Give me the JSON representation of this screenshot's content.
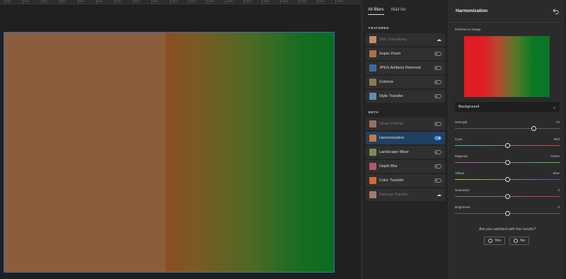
{
  "canvas": {
    "ruler_numbers": [
      "100",
      "200",
      "300",
      "400",
      "500",
      "600",
      "700",
      "800",
      "900",
      "1000",
      "1100",
      "1200",
      "1300",
      "1400",
      "1500",
      "1600",
      "1700",
      "1800",
      "1900"
    ],
    "photo_left_color": "#8a5e3a",
    "photo_right_gradient": "linear-gradient(90deg, #8b4f22 0%, #7a5a24 20%, #4f6924 50%, #176d22 80%, #0a6d1c 100%)"
  },
  "filters": {
    "tabs": [
      {
        "label": "All filters",
        "active": true
      },
      {
        "label": "Wait list",
        "active": false
      }
    ],
    "featured_title": "FEATURED",
    "beta_title": "BETA",
    "featured": [
      {
        "label": "Skin Smoothing",
        "thumb": "#c38c6a",
        "control": "cloud",
        "dim": true
      },
      {
        "label": "Super Zoom",
        "thumb": "#b06e4e",
        "control": "toggle",
        "on": false
      },
      {
        "label": "JPEG Artifacts Removal",
        "thumb": "#3b6aa0",
        "control": "toggle",
        "on": false
      },
      {
        "label": "Colorize",
        "thumb": "#8b7b52",
        "control": "toggle",
        "on": false
      },
      {
        "label": "Style Transfer",
        "thumb": "#5f8fb0",
        "control": "toggle",
        "on": false
      }
    ],
    "beta": [
      {
        "label": "Smart Portrait",
        "thumb": "#9a7060",
        "control": "toggle",
        "on": false,
        "dim": true
      },
      {
        "label": "Harmonization",
        "thumb": "#c47b3e",
        "control": "toggle",
        "on": true,
        "active": true
      },
      {
        "label": "Landscape Mixer",
        "thumb": "#7a8a5a",
        "control": "toggle",
        "on": false
      },
      {
        "label": "Depth Blur",
        "thumb": "#b05a6a",
        "control": "toggle",
        "on": false
      },
      {
        "label": "Color Transfer",
        "thumb": "#d06a2e",
        "control": "toggle",
        "on": false
      },
      {
        "label": "Makeup Transfer",
        "thumb": "#a87a6a",
        "control": "cloud",
        "dim": true
      }
    ]
  },
  "panel": {
    "title": "Harmonization",
    "reference_label": "Reference image",
    "select_value": "Background",
    "sliders": [
      {
        "id": "strength",
        "left": "Strength",
        "right": "75",
        "value": 0.75,
        "track": "#5d5d5d"
      },
      {
        "id": "cyan-red",
        "left": "Cyan",
        "right": "Red",
        "value": 0.5,
        "track": "linear-gradient(90deg,#3fb8c8,#c84040)"
      },
      {
        "id": "magenta-green",
        "left": "Magenta",
        "right": "Green",
        "value": 0.5,
        "track": "linear-gradient(90deg,#b84cb8,#4cb84c)"
      },
      {
        "id": "yellow-blue",
        "left": "Yellow",
        "right": "Blue",
        "value": 0.5,
        "track": "linear-gradient(90deg,#c8c040,#4050c8)"
      },
      {
        "id": "saturation",
        "left": "Saturation",
        "right": "0",
        "value": 0.5,
        "track": "linear-gradient(90deg,#7a7a7a,#c84040)"
      },
      {
        "id": "brightness",
        "left": "Brightness",
        "right": "0",
        "value": 0.5,
        "track": "#5d5d5d"
      }
    ],
    "satisfied_text": "Are you satisfied with the results?",
    "yes_label": "Yes",
    "no_label": "No"
  }
}
